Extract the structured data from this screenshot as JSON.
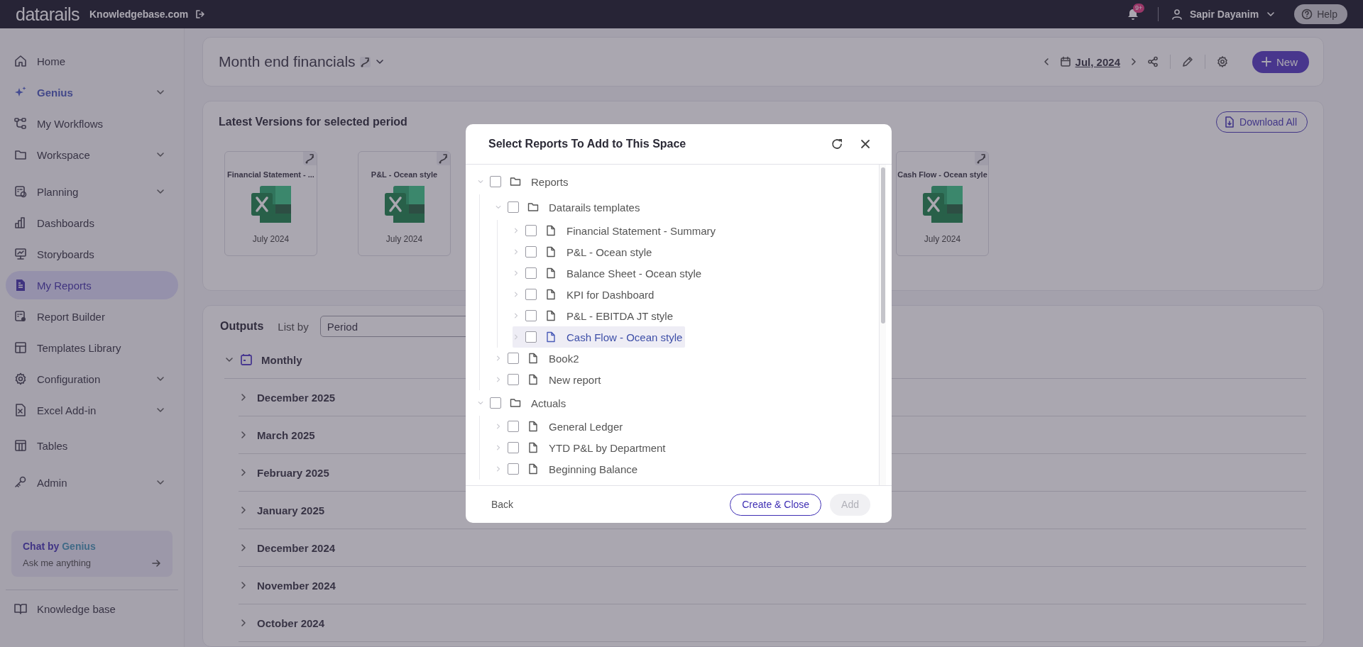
{
  "top_bar": {
    "logo": "datarails",
    "workspace": "Knowledgebase.com",
    "notifications_badge": "9+",
    "user": "Sapir Dayanim",
    "help": "Help"
  },
  "sidebar": {
    "items": [
      {
        "label": "Home",
        "kind": "link",
        "expandable": false,
        "selected": false
      },
      {
        "label": "Genius",
        "kind": "genius",
        "expandable": true,
        "selected": false
      },
      {
        "label": "My Workflows",
        "kind": "link",
        "expandable": false,
        "selected": false
      },
      {
        "label": "Workspace",
        "kind": "link",
        "expandable": true,
        "selected": false
      },
      {
        "label": "Planning",
        "kind": "link",
        "expandable": true,
        "selected": false
      },
      {
        "label": "Dashboards",
        "kind": "link",
        "expandable": false,
        "selected": false
      },
      {
        "label": "Storyboards",
        "kind": "link",
        "expandable": false,
        "selected": false
      },
      {
        "label": "My Reports",
        "kind": "link",
        "expandable": false,
        "selected": true
      },
      {
        "label": "Report Builder",
        "kind": "link",
        "expandable": false,
        "selected": false
      },
      {
        "label": "Templates Library",
        "kind": "link",
        "expandable": false,
        "selected": false
      },
      {
        "label": "Configuration",
        "kind": "link",
        "expandable": true,
        "selected": false
      },
      {
        "label": "Excel Add-in",
        "kind": "link",
        "expandable": true,
        "selected": false
      },
      {
        "label": "Tables",
        "kind": "link",
        "expandable": false,
        "selected": false
      },
      {
        "label": "Admin",
        "kind": "link",
        "expandable": true,
        "selected": false
      }
    ],
    "chat_card": {
      "title": "Chat by",
      "accent": "Genius",
      "placeholder": "Ask me anything"
    },
    "footer_item": "Knowledge base"
  },
  "header": {
    "title": "Month end financials",
    "period": "Jul, 2024",
    "new_button": "New"
  },
  "latest_versions": {
    "title": "Latest Versions for selected period",
    "download_button": "Download All",
    "cards": [
      {
        "title": "Financial Statement - ...",
        "date": "July 2024"
      },
      {
        "title": "P&L - Ocean style",
        "date": "July 2024"
      },
      {
        "title": "Cash Flow - Ocean style",
        "date": "July 2024"
      }
    ]
  },
  "outputs": {
    "title": "Outputs",
    "list_by_label": "List by",
    "list_by_value": "Period",
    "group": {
      "label": "Monthly",
      "expanded": true,
      "rows": [
        {
          "label": "December 2025",
          "expanded": false
        },
        {
          "label": "March 2025",
          "expanded": false
        },
        {
          "label": "February 2025",
          "expanded": false
        },
        {
          "label": "January 2025",
          "expanded": false
        },
        {
          "label": "December 2024",
          "expanded": false
        },
        {
          "label": "November 2024",
          "expanded": false
        },
        {
          "label": "October 2024",
          "expanded": false
        }
      ]
    }
  },
  "modal": {
    "title": "Select Reports To Add to This Space",
    "tree": [
      {
        "label": "Reports",
        "kind": "folder",
        "checked": false,
        "expanded": true,
        "selected": false,
        "children": [
          {
            "label": "Datarails templates",
            "kind": "folder",
            "checked": false,
            "expanded": true,
            "selected": false,
            "children": [
              {
                "label": "Financial Statement - Summary",
                "kind": "file",
                "checked": false,
                "expanded": false,
                "selected": false
              },
              {
                "label": "P&L - Ocean style",
                "kind": "file",
                "checked": false,
                "expanded": false,
                "selected": false
              },
              {
                "label": "Balance Sheet - Ocean style",
                "kind": "file",
                "checked": false,
                "expanded": false,
                "selected": false
              },
              {
                "label": "KPI for Dashboard",
                "kind": "file",
                "checked": false,
                "expanded": false,
                "selected": false
              },
              {
                "label": "P&L - EBITDA JT style",
                "kind": "file",
                "checked": false,
                "expanded": false,
                "selected": false
              },
              {
                "label": "Cash Flow - Ocean style",
                "kind": "file",
                "checked": false,
                "expanded": false,
                "selected": true
              }
            ]
          },
          {
            "label": "Book2",
            "kind": "file",
            "checked": false,
            "expanded": false,
            "selected": false
          },
          {
            "label": "New report",
            "kind": "file",
            "checked": false,
            "expanded": false,
            "selected": false
          }
        ]
      },
      {
        "label": "Actuals",
        "kind": "folder",
        "checked": false,
        "expanded": true,
        "selected": false,
        "children": [
          {
            "label": "General Ledger",
            "kind": "file",
            "checked": false,
            "expanded": false,
            "selected": false
          },
          {
            "label": "YTD P&L by Department",
            "kind": "file",
            "checked": false,
            "expanded": false,
            "selected": false
          },
          {
            "label": "Beginning Balance",
            "kind": "file",
            "checked": false,
            "expanded": false,
            "selected": false
          }
        ]
      }
    ],
    "back": "Back",
    "create_button": "Create & Close",
    "add_button": {
      "label": "Add",
      "disabled": true
    }
  }
}
